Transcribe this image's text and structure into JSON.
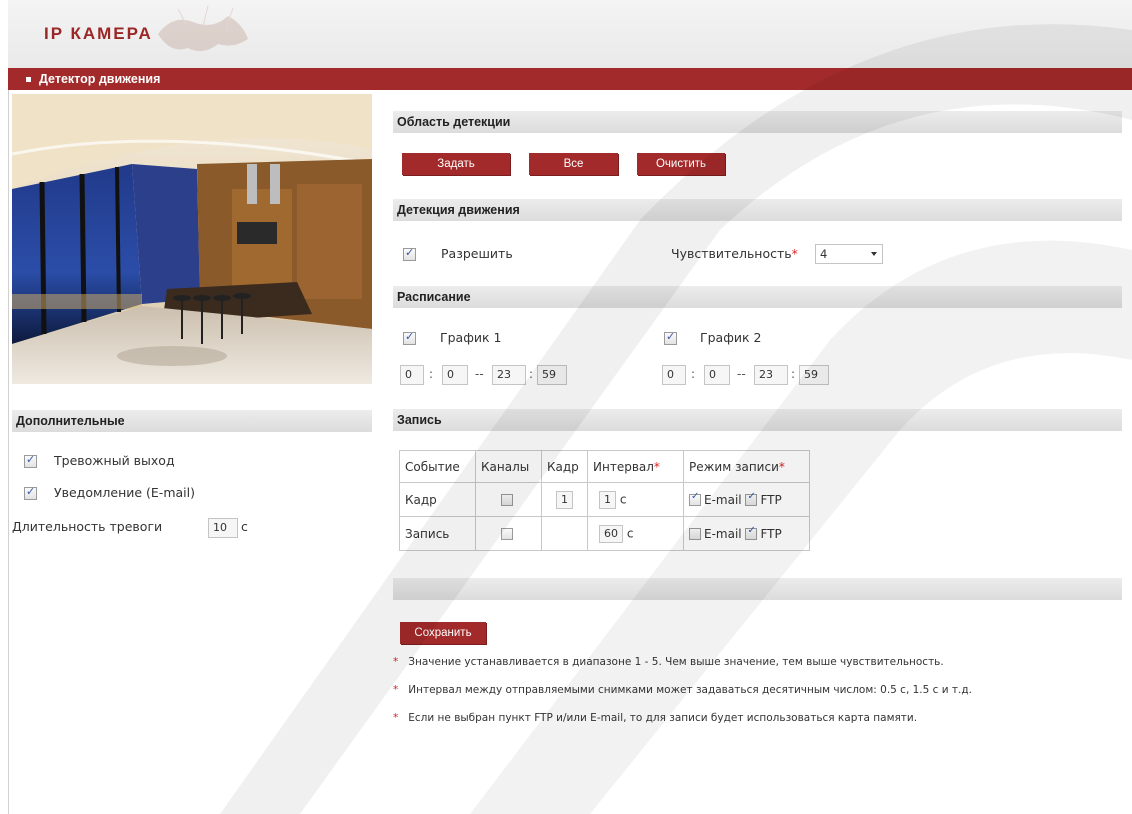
{
  "header": {
    "logo": "IP КАМЕРА",
    "page_title": "Детектор движения"
  },
  "colors": {
    "accent": "#a32a2a",
    "bar": "#e3e3e3",
    "required": "#dd2222"
  },
  "left": {
    "additional_title": "Дополнительные",
    "alarm_output_label": "Тревожный выход",
    "alarm_output_checked": true,
    "email_notify_label": "Уведомление (E-mail)",
    "email_notify_checked": true,
    "duration_label": "Длительность тревоги",
    "duration_value": "10",
    "duration_unit": "с"
  },
  "detection_area": {
    "title": "Область детекции",
    "btn_set": "Задать",
    "btn_all": "Все",
    "btn_clear": "Очистить"
  },
  "motion": {
    "title": "Детекция движения",
    "enable_label": "Разрешить",
    "enable_checked": true,
    "sensitivity_label": "Чувствительность",
    "required_mark": "*",
    "sensitivity_value": "4"
  },
  "schedule": {
    "title": "Расписание",
    "s1_label": "График 1",
    "s1_checked": true,
    "s1_start_h": "0",
    "s1_start_m": "0",
    "s1_end_h": "23",
    "s1_end_m": "59",
    "s2_label": "График 2",
    "s2_checked": true,
    "s2_start_h": "0",
    "s2_start_m": "0",
    "s2_end_h": "23",
    "s2_end_m": "59",
    "colon": ":",
    "dash": "--"
  },
  "record": {
    "title": "Запись",
    "columns": [
      "Событие",
      "Каналы",
      "Кадр",
      "Интервал",
      "Режим записи"
    ],
    "rows": [
      {
        "event": "Кадр",
        "channels_checked": false,
        "frame": "1",
        "interval": "1",
        "unit": "с",
        "email_checked": true,
        "email_label": "E-mail",
        "ftp_checked": true,
        "ftp_label": "FTP"
      },
      {
        "event": "Запись",
        "channels_checked": false,
        "frame": "",
        "interval": "60",
        "unit": "с",
        "email_checked": false,
        "email_label": "E-mail",
        "ftp_checked": true,
        "ftp_label": "FTP"
      }
    ]
  },
  "save_label": "Сохранить",
  "notes": [
    "Значение устанавливается в диапазоне 1 - 5. Чем выше значение, тем выше чувствительность.",
    "Интервал между отправляемыми снимками может задаваться десятичным числом: 0.5 с, 1.5 с и т.д.",
    "Если не выбран пункт FTP и/или E-mail, то для записи будет использоваться карта памяти."
  ]
}
